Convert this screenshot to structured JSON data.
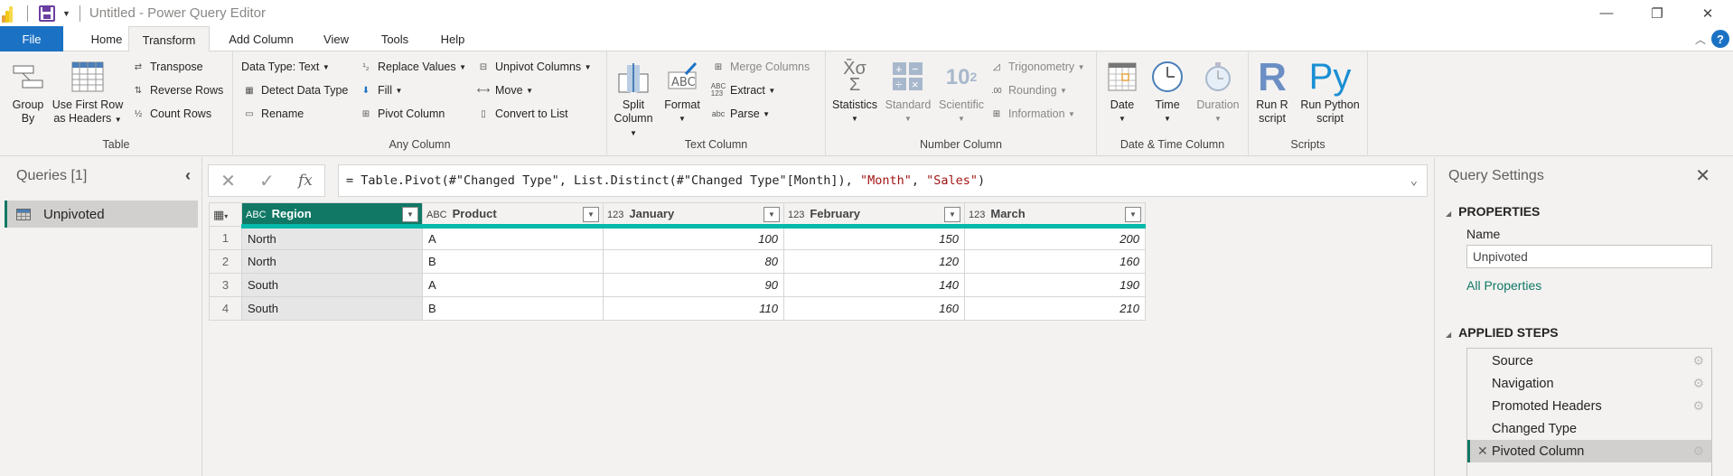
{
  "titlebar": {
    "title": "Untitled - Power Query Editor",
    "minimize_icon": "—",
    "restore_icon": "❐",
    "close_icon": "✕"
  },
  "tabs": [
    {
      "label": "File"
    },
    {
      "label": "Home"
    },
    {
      "label": "Transform",
      "active": true
    },
    {
      "label": "Add Column"
    },
    {
      "label": "View"
    },
    {
      "label": "Tools"
    },
    {
      "label": "Help"
    }
  ],
  "ribbon": {
    "table": {
      "label": "Table",
      "group_by": "Group\nBy",
      "group_by_l1": "Group",
      "group_by_l2": "By",
      "first_row_l1": "Use First Row",
      "first_row_l2": "as Headers",
      "transpose": "Transpose",
      "reverse_rows": "Reverse Rows",
      "count_rows": "Count Rows"
    },
    "any_column": {
      "label": "Any Column",
      "data_type": "Data Type: Text",
      "detect_data_type": "Detect Data Type",
      "rename": "Rename",
      "replace_values": "Replace Values",
      "fill": "Fill",
      "pivot_column": "Pivot Column",
      "unpivot_columns": "Unpivot Columns",
      "move": "Move",
      "convert_to_list": "Convert to List"
    },
    "text_column": {
      "label": "Text Column",
      "split_l1": "Split",
      "split_l2": "Column",
      "format": "Format",
      "merge_columns": "Merge Columns",
      "extract": "Extract",
      "parse": "Parse"
    },
    "number_column": {
      "label": "Number Column",
      "statistics": "Statistics",
      "standard": "Standard",
      "scientific": "Scientific",
      "trigonometry": "Trigonometry",
      "rounding": "Rounding",
      "information": "Information"
    },
    "datetime_column": {
      "label": "Date & Time Column",
      "date": "Date",
      "time": "Time",
      "duration": "Duration"
    },
    "scripts": {
      "label": "Scripts",
      "r_l1": "Run R",
      "r_l2": "script",
      "py_l1": "Run Python",
      "py_l2": "script"
    }
  },
  "queries": {
    "title": "Queries [1]",
    "items": [
      {
        "label": "Unpivoted",
        "selected": true
      }
    ]
  },
  "formula_bar": {
    "prefix": "= Table.Pivot(#\"Changed Type\", List.Distinct(#\"Changed Type\"[Month]), ",
    "arg1": "\"Month\"",
    "comma": ", ",
    "arg2": "\"Sales\"",
    "suffix": ")"
  },
  "grid": {
    "columns": [
      {
        "name": "Region",
        "type": "ABC",
        "selected": true
      },
      {
        "name": "Product",
        "type": "ABC"
      },
      {
        "name": "January",
        "type": "123"
      },
      {
        "name": "February",
        "type": "123"
      },
      {
        "name": "March",
        "type": "123"
      }
    ],
    "rows": [
      {
        "n": "1",
        "cells": [
          "North",
          "A",
          "100",
          "150",
          "200"
        ]
      },
      {
        "n": "2",
        "cells": [
          "North",
          "B",
          "80",
          "120",
          "160"
        ]
      },
      {
        "n": "3",
        "cells": [
          "South",
          "A",
          "90",
          "140",
          "190"
        ]
      },
      {
        "n": "4",
        "cells": [
          "South",
          "B",
          "110",
          "160",
          "210"
        ]
      }
    ]
  },
  "settings": {
    "title": "Query Settings",
    "properties_header": "PROPERTIES",
    "name_label": "Name",
    "name_value": "Unpivoted",
    "all_properties": "All Properties",
    "steps_header": "APPLIED STEPS",
    "steps": [
      {
        "label": "Source",
        "gear": true
      },
      {
        "label": "Navigation",
        "gear": true
      },
      {
        "label": "Promoted Headers",
        "gear": true
      },
      {
        "label": "Changed Type",
        "gear": false
      },
      {
        "label": "Pivoted Column",
        "gear": true,
        "active": true
      }
    ]
  }
}
